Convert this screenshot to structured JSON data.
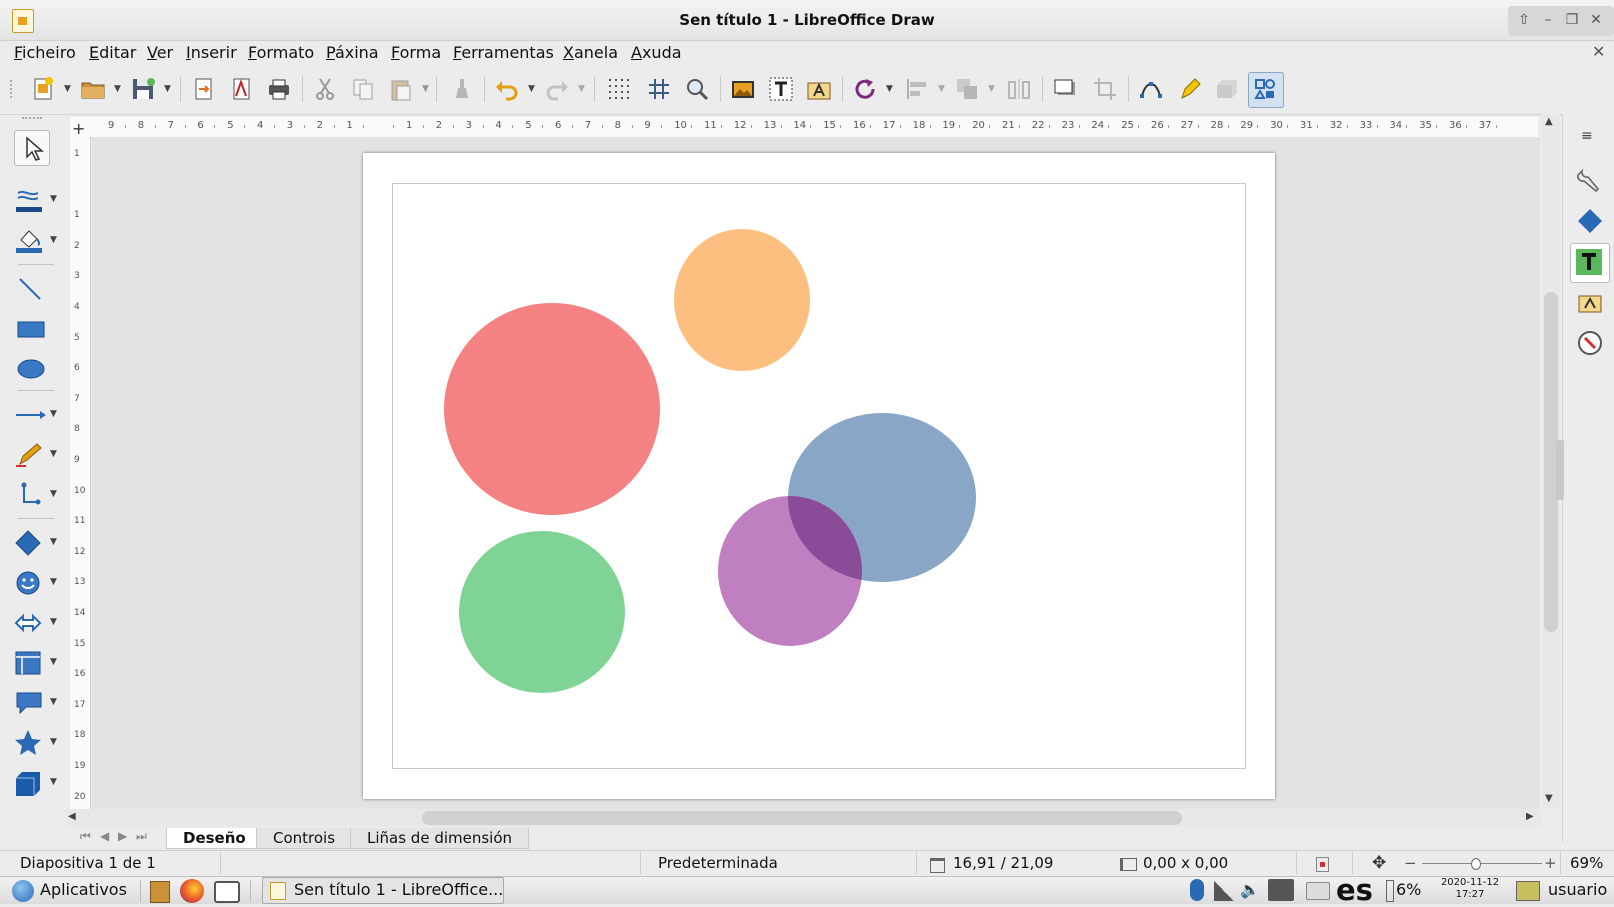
{
  "window": {
    "title": "Sen título 1 - LibreOffice Draw",
    "controls": {
      "up": "⇧",
      "minimize": "–",
      "restore": "❐",
      "close": "✕"
    },
    "doc_close": "✕"
  },
  "menu": [
    {
      "accel": "F",
      "rest": "icheiro"
    },
    {
      "accel": "E",
      "rest": "ditar"
    },
    {
      "accel": "V",
      "rest": "er"
    },
    {
      "accel": "I",
      "rest": "nserir"
    },
    {
      "accel": "F",
      "rest": "ormato"
    },
    {
      "accel": "P",
      "rest": "áxina"
    },
    {
      "accel": "F",
      "rest": "orma"
    },
    {
      "accel": "F",
      "rest": "erramentas"
    },
    {
      "accel": "X",
      "rest": "anela"
    },
    {
      "accel": "A",
      "rest": "xuda"
    }
  ],
  "ruler": {
    "horizontal": [
      "9",
      "8",
      "7",
      "6",
      "5",
      "4",
      "3",
      "2",
      "1",
      "",
      "1",
      "2",
      "3",
      "4",
      "5",
      "6",
      "7",
      "8",
      "9",
      "10",
      "11",
      "12",
      "13",
      "14",
      "15",
      "16",
      "17",
      "18",
      "19",
      "20",
      "21",
      "22",
      "23",
      "24",
      "25",
      "26",
      "27",
      "28",
      "29",
      "30",
      "31",
      "32",
      "33",
      "34",
      "35",
      "36",
      "37"
    ],
    "vertical": [
      "1",
      "",
      "1",
      "2",
      "3",
      "4",
      "5",
      "6",
      "7",
      "8",
      "9",
      "10",
      "11",
      "12",
      "13",
      "14",
      "15",
      "16",
      "17",
      "18",
      "19",
      "20"
    ]
  },
  "shapes": {
    "orange": "#fdbf7f",
    "red": "#f58282",
    "blue": "#8aa6c6",
    "purple": "#c07fc1",
    "green": "#7fd396",
    "overlap": "#8a4b98"
  },
  "tabs": [
    "Deseño",
    "Controis",
    "Liñas de dimensión"
  ],
  "tab_nav": [
    "⏮",
    "◀",
    "▶",
    "⏭"
  ],
  "status": {
    "slide": "Diapositiva 1 de 1",
    "master": "Predeterminada",
    "position": "16,91 / 21,09",
    "size": "0,00 x 0,00",
    "zoom_minus": "−",
    "zoom_plus": "+",
    "zoom": "69%",
    "zoom_level": 0.45
  },
  "taskbar": {
    "start": "Aplicativos",
    "task": "Sen título 1 - LibreOffice...",
    "lang": "es",
    "battery": "6%",
    "date": "2020-11-12",
    "time": "17:27",
    "user": "usuario"
  }
}
